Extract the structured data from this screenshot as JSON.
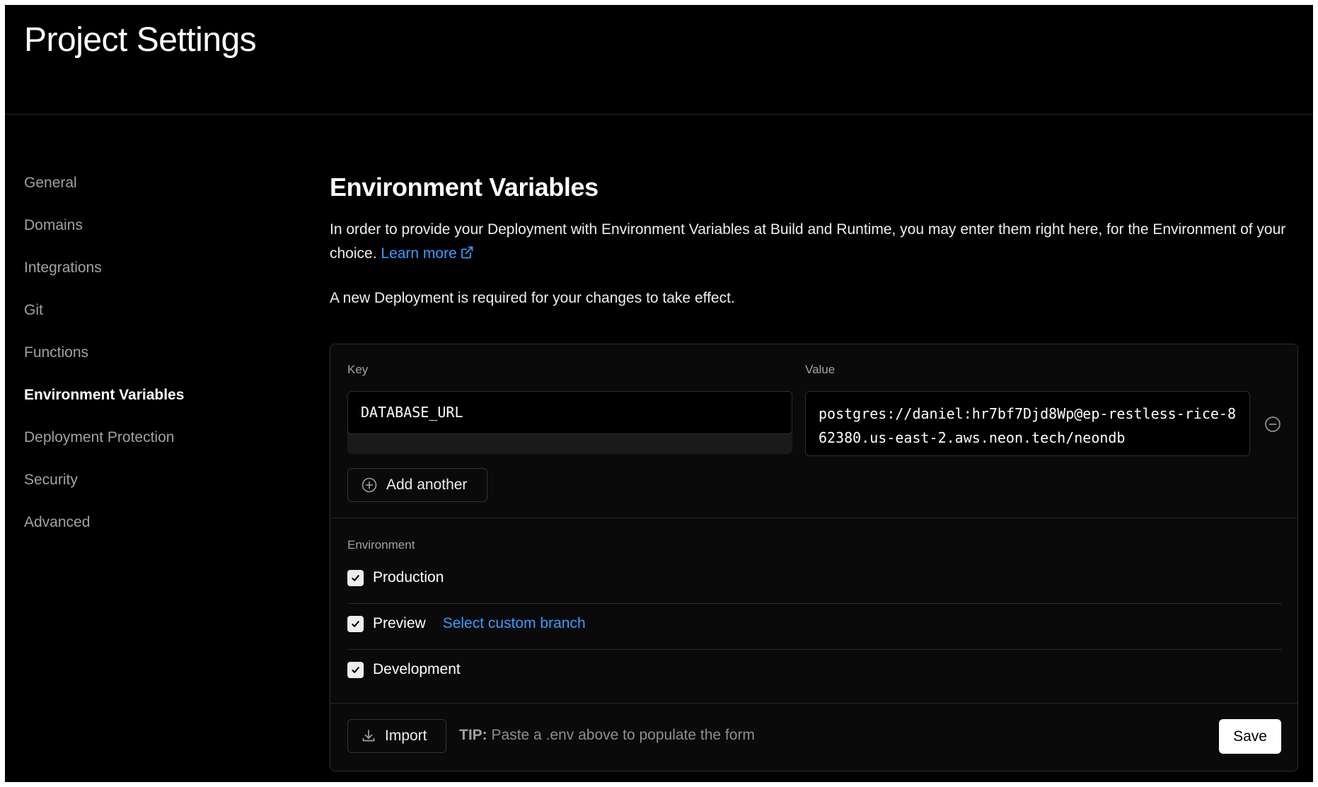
{
  "header": {
    "title": "Project Settings"
  },
  "sidebar": {
    "items": [
      {
        "label": "General"
      },
      {
        "label": "Domains"
      },
      {
        "label": "Integrations"
      },
      {
        "label": "Git"
      },
      {
        "label": "Functions"
      },
      {
        "label": "Environment Variables",
        "active": true
      },
      {
        "label": "Deployment Protection"
      },
      {
        "label": "Security"
      },
      {
        "label": "Advanced"
      }
    ]
  },
  "main": {
    "title": "Environment Variables",
    "description": "In order to provide your Deployment with Environment Variables at Build and Runtime, you may enter them right here, for the Environment of your choice.",
    "learn_more": "Learn more",
    "notice": "A new Deployment is required for your changes to take effect."
  },
  "form": {
    "key_label": "Key",
    "value_label": "Value",
    "key_value": "DATABASE_URL",
    "value_value": "postgres://daniel:hr7bf7Djd8Wp@ep-restless-rice-862380.us-east-2.aws.neon.tech/neondb",
    "add_another": "Add another",
    "environment_label": "Environment",
    "environments": [
      {
        "label": "Production",
        "checked": true
      },
      {
        "label": "Preview",
        "checked": true,
        "link": "Select custom branch"
      },
      {
        "label": "Development",
        "checked": true
      }
    ],
    "import_label": "Import",
    "tip_prefix": "TIP:",
    "tip_text": "Paste a .env above to populate the form",
    "save_label": "Save"
  },
  "colors": {
    "background": "#000000",
    "link": "#3b9bff",
    "muted_text": "#a1a1a1",
    "border": "#2e2e2e"
  },
  "icons": [
    "external-link-icon",
    "remove-circle-icon",
    "plus-circle-icon",
    "checkmark-icon",
    "download-icon"
  ]
}
